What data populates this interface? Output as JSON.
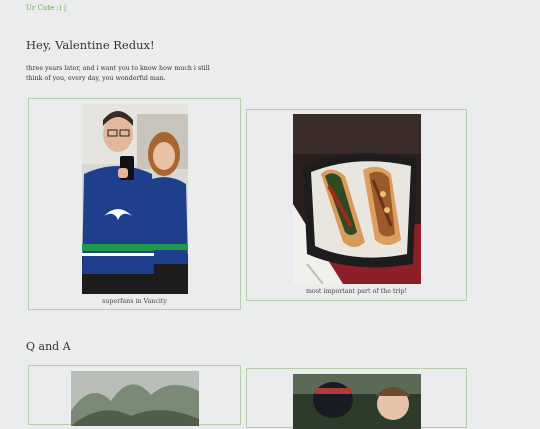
{
  "blog": {
    "link_text": "Ur Cute :) |"
  },
  "post": {
    "title": "Hey, Valentine Redux!",
    "body": "three years later, and i want you to know how much i still think of you, every day, you wonderful man."
  },
  "photos": [
    {
      "caption": "superfans in Vancity"
    },
    {
      "caption": "most important part of the trip!"
    }
  ],
  "section2": {
    "title": "Q and A"
  },
  "colors": {
    "background": "#ebecee",
    "frame_border": "#b6cfa8",
    "link": "#6aa84f"
  }
}
